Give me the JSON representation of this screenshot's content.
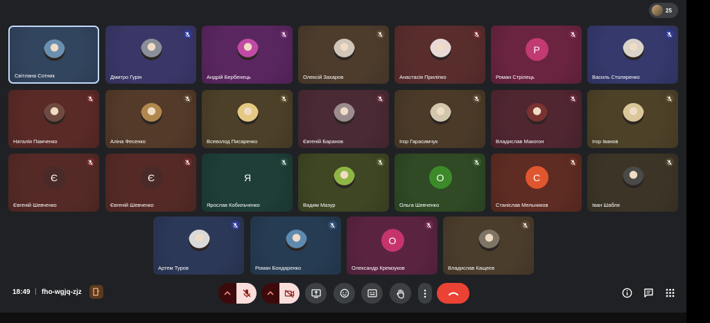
{
  "meeting": {
    "time": "18:49",
    "separator": "|",
    "code": "fho-wgjq-zjz",
    "participants_count": "25"
  },
  "tiles": [
    {
      "name": "Світлана Сотник",
      "avatar": "photo",
      "letter": "",
      "bg": "#32455e",
      "avbg": "#6b8fb0",
      "mic": "none",
      "active": true
    },
    {
      "name": "Дмитро Гурін",
      "avatar": "photo",
      "letter": "",
      "bg": "#3a3768",
      "avbg": "#8a8f99",
      "mic": "muted",
      "mic_color": "#2e3a92"
    },
    {
      "name": "Андрій Бербенець",
      "avatar": "photo",
      "letter": "",
      "bg": "#5a2660",
      "avbg": "#c04aa6",
      "mic": "muted",
      "mic_color": "#6c2c6e"
    },
    {
      "name": "Олексій Захаров",
      "avatar": "photo",
      "letter": "",
      "bg": "#4d3c2c",
      "avbg": "#cfc6b8",
      "mic": "muted",
      "mic_color": "#5b4530"
    },
    {
      "name": "Анастасія Приліпко",
      "avatar": "photo",
      "letter": "",
      "bg": "#5a2d2d",
      "avbg": "#e8d8d6",
      "mic": "muted",
      "mic_color": "#6e2a2a"
    },
    {
      "name": "Роман Стрілець",
      "avatar": "letter",
      "letter": "Р",
      "bg": "#6a2440",
      "avbg": "#c23a72",
      "mic": "muted",
      "mic_color": "#7a2848"
    },
    {
      "name": "Василь Столяренко",
      "avatar": "photo",
      "letter": "",
      "bg": "#35396c",
      "avbg": "#d9d3c9",
      "mic": "muted",
      "mic_color": "#2e3a92"
    },
    {
      "name": "Наталія Памченко",
      "avatar": "photo",
      "letter": "",
      "bg": "#5a2a27",
      "avbg": "#6f4a40",
      "mic": "muted",
      "mic_color": "#6e2a2a"
    },
    {
      "name": "Аліна Фесенко",
      "avatar": "photo",
      "letter": "",
      "bg": "#543a29",
      "avbg": "#b0884f",
      "mic": "muted",
      "mic_color": "#5b4530"
    },
    {
      "name": "Всеволод Писаренко",
      "avatar": "photo",
      "letter": "",
      "bg": "#4d4029",
      "avbg": "#e4c982",
      "mic": "muted",
      "mic_color": "#5b4a2a"
    },
    {
      "name": "Євгеній Баранов",
      "avatar": "photo",
      "letter": "",
      "bg": "#4a2a34",
      "avbg": "#9c8b8f",
      "mic": "muted",
      "mic_color": "#5e2c3a"
    },
    {
      "name": "Ігор Гарасимчук",
      "avatar": "photo",
      "letter": "",
      "bg": "#4b3a28",
      "avbg": "#d2c6ad",
      "mic": "muted",
      "mic_color": "#5b4530"
    },
    {
      "name": "Владислав Макогон",
      "avatar": "photo",
      "letter": "",
      "bg": "#502631",
      "avbg": "#7a3330",
      "mic": "muted",
      "mic_color": "#64283a"
    },
    {
      "name": "Ігор Іванов",
      "avatar": "photo",
      "letter": "",
      "bg": "#4d4128",
      "avbg": "#d9c79a",
      "mic": "muted",
      "mic_color": "#5b4a2a"
    },
    {
      "name": "Євгеній Шевченко",
      "avatar": "letter",
      "letter": "Є",
      "bg": "#552a26",
      "avbg": "#4a2a28",
      "mic": "muted",
      "mic_color": "#6e2a2a"
    },
    {
      "name": "Євгеній Шевченко",
      "avatar": "letter",
      "letter": "Є",
      "bg": "#552a26",
      "avbg": "#4a2a28",
      "mic": "muted",
      "mic_color": "#6e2a2a"
    },
    {
      "name": "Ярослав Кобильченко",
      "avatar": "letter",
      "letter": "Я",
      "bg": "#1e3e37",
      "avbg": "#1e3e37",
      "mic": "muted",
      "mic_color": "#244a40"
    },
    {
      "name": "Вадим Мазур",
      "avatar": "photo",
      "letter": "",
      "bg": "#3f4624",
      "avbg": "#8fb544",
      "mic": "muted",
      "mic_color": "#4c5528"
    },
    {
      "name": "Ольга Шевченко",
      "avatar": "letter",
      "letter": "О",
      "bg": "#2f4a25",
      "avbg": "#3d8a2a",
      "mic": "muted",
      "mic_color": "#385a2c"
    },
    {
      "name": "Станіслав Мельников",
      "avatar": "letter",
      "letter": "С",
      "bg": "#5e2c22",
      "avbg": "#e0562e",
      "mic": "muted",
      "mic_color": "#6e3024"
    },
    {
      "name": "Іван Шабля",
      "avatar": "photo",
      "letter": "",
      "bg": "#3c3527",
      "avbg": "#4a4a48",
      "mic": "muted",
      "mic_color": "#4d432c"
    },
    {
      "name": "Артем Туров",
      "avatar": "photo",
      "letter": "",
      "bg": "#2c3858",
      "avbg": "#d9d9d9",
      "mic": "muted",
      "mic_color": "#2e3a92"
    },
    {
      "name": "Роман Бондаренко",
      "avatar": "photo",
      "letter": "",
      "bg": "#263c52",
      "avbg": "#5f8ab0",
      "mic": "muted",
      "mic_color": "#2a4a6e"
    },
    {
      "name": "Олександр Кремзуков",
      "avatar": "letter",
      "letter": "О",
      "bg": "#5a2440",
      "avbg": "#c6346e",
      "mic": "muted",
      "mic_color": "#6e2848"
    },
    {
      "name": "Владислав Кащеєв",
      "avatar": "photo",
      "letter": "",
      "bg": "#4b3d2c",
      "avbg": "#7e7565",
      "mic": "muted",
      "mic_color": "#5b4530"
    }
  ],
  "controls": [
    {
      "name": "mic-toggle",
      "label": "microphone off"
    },
    {
      "name": "camera-toggle",
      "label": "camera off"
    },
    {
      "name": "present",
      "label": "present screen"
    },
    {
      "name": "reactions",
      "label": "reactions"
    },
    {
      "name": "captions",
      "label": "captions"
    },
    {
      "name": "raise-hand",
      "label": "raise hand"
    },
    {
      "name": "more-options",
      "label": "more options"
    },
    {
      "name": "leave-call",
      "label": "leave call"
    }
  ],
  "right_controls": [
    {
      "name": "meeting-details",
      "label": "meeting details"
    },
    {
      "name": "chat",
      "label": "chat"
    },
    {
      "name": "activities",
      "label": "activities"
    }
  ]
}
